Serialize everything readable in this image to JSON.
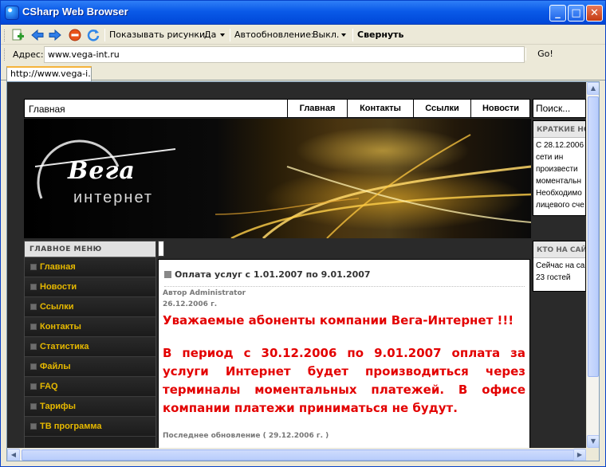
{
  "window": {
    "title": "CSharp Web Browser"
  },
  "toolbar": {
    "show_images_label": "Показывать рисунки:",
    "show_images_value": "Да",
    "autorefresh_label": "Автообновление:",
    "autorefresh_value": "Выкл.",
    "collapse_label": "Свернуть"
  },
  "address": {
    "label": "Адрес:",
    "url": "www.vega-int.ru",
    "go_label": "Go!"
  },
  "tab": {
    "label": "http://www.vega-i..."
  },
  "site": {
    "breadcrumb": "Главная",
    "nav": [
      "Главная",
      "Контакты",
      "Ссылки",
      "Новости"
    ],
    "search_placeholder": "Поиск...",
    "brand": "Вега",
    "brand_sub": "интернет",
    "news_box": {
      "title": "КРАТКИЕ НО",
      "lines": [
        "С  28.12.2006",
        "сети      ин",
        "произвести",
        "моментальн",
        "Необходимо",
        "лицевого сче"
      ]
    },
    "online_box": {
      "title": "КТО НА САЙ",
      "lines": [
        "Сейчас на са",
        "23 гостей"
      ]
    },
    "menu": {
      "title": "ГЛАВНОЕ МЕНЮ",
      "items": [
        "Главная",
        "Новости",
        "Ссылки",
        "Контакты",
        "Статистика",
        "Файлы",
        "FAQ",
        "Тарифы",
        "ТВ программа"
      ]
    },
    "article": {
      "title": "Оплата услуг с 1.01.2007 по 9.01.2007",
      "author": "Автор Administrator",
      "date": "26.12.2006 г.",
      "para1": "Уважаемые абоненты компании Вега-Интернет !!!",
      "para2": "В период с 30.12.2006 по 9.01.2007 оплата за услуги Интернет будет производиться  через терминалы моментальных платежей. В офисе компании платежи приниматься не будут.",
      "updated": "Последнее обновление ( 29.12.2006 г. )"
    }
  },
  "colors": {
    "menu_text": "#e6b800",
    "alert_text": "#e30000",
    "titlebar": "#0a5ae8"
  }
}
